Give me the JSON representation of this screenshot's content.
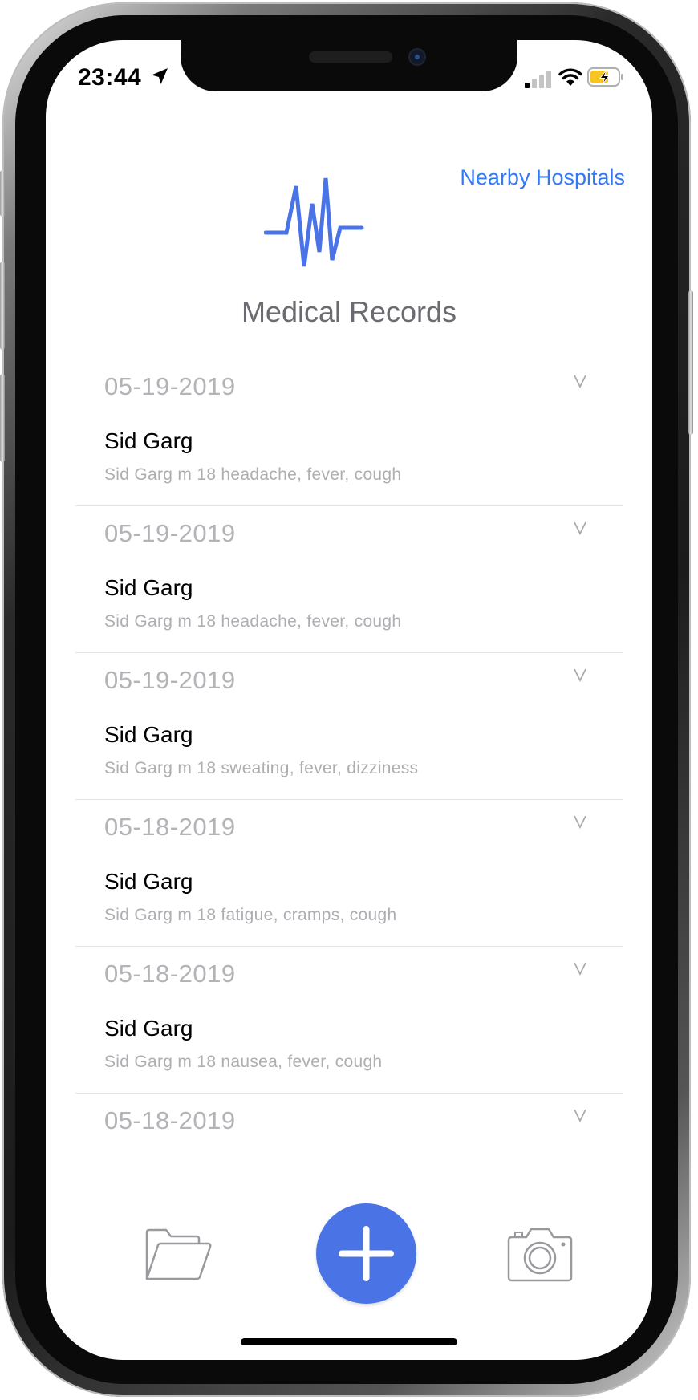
{
  "status_bar": {
    "time": "23:44"
  },
  "header": {
    "nearby_link": "Nearby Hospitals",
    "title": "Medical Records"
  },
  "records": [
    {
      "date": "05-19-2019",
      "name": "Sid Garg",
      "details": "Sid Garg m 18 headache, fever, cough"
    },
    {
      "date": "05-19-2019",
      "name": "Sid Garg",
      "details": "Sid Garg m 18 headache, fever, cough"
    },
    {
      "date": "05-19-2019",
      "name": "Sid Garg",
      "details": "Sid Garg m 18 sweating, fever, dizziness"
    },
    {
      "date": "05-18-2019",
      "name": "Sid Garg",
      "details": "Sid Garg m 18 fatigue, cramps, cough"
    },
    {
      "date": "05-18-2019",
      "name": "Sid Garg",
      "details": "Sid Garg m 18 nausea, fever, cough"
    },
    {
      "date": "05-18-2019"
    }
  ],
  "toolbar": {
    "folder_icon": "folder-icon",
    "add_icon": "plus-icon",
    "camera_icon": "camera-icon"
  },
  "colors": {
    "accent": "#3478f6",
    "add_button": "#4a74e6",
    "logo": "#4a74e6",
    "muted_text": "#b4b4b8"
  }
}
